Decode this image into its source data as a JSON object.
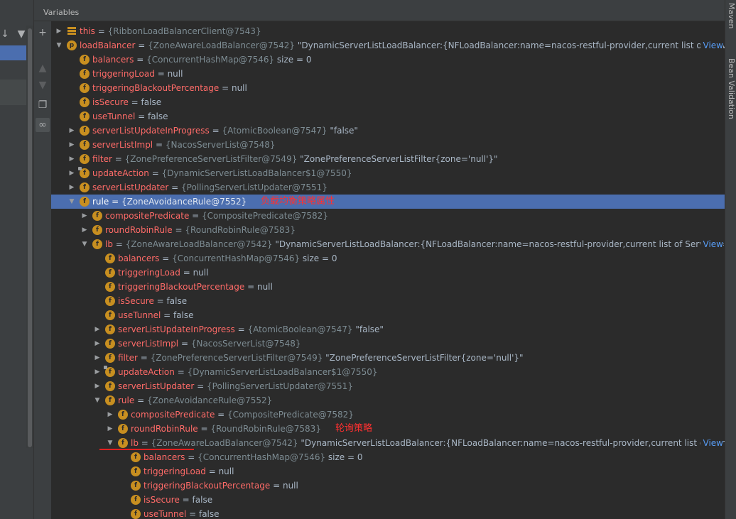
{
  "panel_title": "Variables",
  "view_label": "View",
  "side_tabs": [
    "Maven",
    "Bean Validation"
  ],
  "frames_toolbar": {
    "down_icon": "arrow-down-icon",
    "filter_icon": "filter-icon"
  },
  "vars_toolbar": [
    {
      "icon": "plus-icon",
      "glyph": "+",
      "enabled": true
    },
    {
      "icon": "arrow-up-icon",
      "glyph": "▲",
      "enabled": false
    },
    {
      "icon": "arrow-down-icon",
      "glyph": "▼",
      "enabled": false
    },
    {
      "icon": "copy-icon",
      "glyph": "❐",
      "enabled": true
    },
    {
      "icon": "watch-glasses-icon",
      "glyph": "∞",
      "enabled": true,
      "active": true
    }
  ],
  "annotations": {
    "rule": "负载均衡策略属性",
    "round_robin": "轮询策略"
  },
  "rows": [
    {
      "level": 0,
      "arrow": "collapsed",
      "icon": "stack",
      "name": "this",
      "ref": "{RibbonLoadBalancerClient@7543}",
      "rest": ""
    },
    {
      "level": 0,
      "arrow": "expanded",
      "icon": "p",
      "name": "loadBalancer",
      "ref": "{ZoneAwareLoadBalancer@7542}",
      "rest": " \"DynamicServerListLoadBalancer:{NFLoadBalancer:name=nacos-restful-provider,current list of Serv…",
      "view": true
    },
    {
      "level": 1,
      "arrow": "",
      "icon": "f",
      "name": "balancers",
      "ref": "{ConcurrentHashMap@7546}",
      "rest": "  size = 0"
    },
    {
      "level": 1,
      "arrow": "",
      "icon": "f",
      "name": "triggeringLoad",
      "ref": "",
      "rest": "null"
    },
    {
      "level": 1,
      "arrow": "",
      "icon": "f",
      "name": "triggeringBlackoutPercentage",
      "ref": "",
      "rest": "null"
    },
    {
      "level": 1,
      "arrow": "",
      "icon": "f",
      "name": "isSecure",
      "ref": "",
      "rest": "false"
    },
    {
      "level": 1,
      "arrow": "",
      "icon": "f",
      "name": "useTunnel",
      "ref": "",
      "rest": "false"
    },
    {
      "level": 1,
      "arrow": "collapsed",
      "icon": "f",
      "name": "serverListUpdateInProgress",
      "ref": "{AtomicBoolean@7547}",
      "rest": " \"false\""
    },
    {
      "level": 1,
      "arrow": "collapsed",
      "icon": "f",
      "name": "serverListImpl",
      "ref": "{NacosServerList@7548}",
      "rest": ""
    },
    {
      "level": 1,
      "arrow": "collapsed",
      "icon": "f",
      "name": "filter",
      "ref": "{ZonePreferenceServerListFilter@7549}",
      "rest": " \"ZonePreferenceServerListFilter{zone='null'}\""
    },
    {
      "level": 1,
      "arrow": "collapsed",
      "icon": "f",
      "lock": true,
      "name": "updateAction",
      "ref": "{DynamicServerListLoadBalancer$1@7550}",
      "rest": ""
    },
    {
      "level": 1,
      "arrow": "collapsed",
      "icon": "f",
      "name": "serverListUpdater",
      "ref": "{PollingServerListUpdater@7551}",
      "rest": ""
    },
    {
      "level": 1,
      "arrow": "expanded",
      "icon": "f",
      "name": "rule",
      "ref": "{ZoneAvoidanceRule@7552}",
      "rest": "",
      "selected": true,
      "annotation": "rule"
    },
    {
      "level": 2,
      "arrow": "collapsed",
      "icon": "f",
      "name": "compositePredicate",
      "ref": "{CompositePredicate@7582}",
      "rest": ""
    },
    {
      "level": 2,
      "arrow": "collapsed",
      "icon": "f",
      "name": "roundRobinRule",
      "ref": "{RoundRobinRule@7583}",
      "rest": ""
    },
    {
      "level": 2,
      "arrow": "expanded",
      "icon": "f",
      "name": "lb",
      "ref": "{ZoneAwareLoadBalancer@7542}",
      "rest": " \"DynamicServerListLoadBalancer:{NFLoadBalancer:name=nacos-restful-provider,current list of Servers=[…",
      "view": true
    },
    {
      "level": 3,
      "arrow": "",
      "icon": "f",
      "name": "balancers",
      "ref": "{ConcurrentHashMap@7546}",
      "rest": "  size = 0"
    },
    {
      "level": 3,
      "arrow": "",
      "icon": "f",
      "name": "triggeringLoad",
      "ref": "",
      "rest": "null"
    },
    {
      "level": 3,
      "arrow": "",
      "icon": "f",
      "name": "triggeringBlackoutPercentage",
      "ref": "",
      "rest": "null"
    },
    {
      "level": 3,
      "arrow": "",
      "icon": "f",
      "name": "isSecure",
      "ref": "",
      "rest": "false"
    },
    {
      "level": 3,
      "arrow": "",
      "icon": "f",
      "name": "useTunnel",
      "ref": "",
      "rest": "false"
    },
    {
      "level": 3,
      "arrow": "collapsed",
      "icon": "f",
      "name": "serverListUpdateInProgress",
      "ref": "{AtomicBoolean@7547}",
      "rest": " \"false\""
    },
    {
      "level": 3,
      "arrow": "collapsed",
      "icon": "f",
      "name": "serverListImpl",
      "ref": "{NacosServerList@7548}",
      "rest": ""
    },
    {
      "level": 3,
      "arrow": "collapsed",
      "icon": "f",
      "name": "filter",
      "ref": "{ZonePreferenceServerListFilter@7549}",
      "rest": " \"ZonePreferenceServerListFilter{zone='null'}\""
    },
    {
      "level": 3,
      "arrow": "collapsed",
      "icon": "f",
      "lock": true,
      "name": "updateAction",
      "ref": "{DynamicServerListLoadBalancer$1@7550}",
      "rest": ""
    },
    {
      "level": 3,
      "arrow": "collapsed",
      "icon": "f",
      "name": "serverListUpdater",
      "ref": "{PollingServerListUpdater@7551}",
      "rest": ""
    },
    {
      "level": 3,
      "arrow": "expanded",
      "icon": "f",
      "name": "rule",
      "ref": "{ZoneAvoidanceRule@7552}",
      "rest": ""
    },
    {
      "level": 4,
      "arrow": "collapsed",
      "icon": "f",
      "name": "compositePredicate",
      "ref": "{CompositePredicate@7582}",
      "rest": ""
    },
    {
      "level": 4,
      "arrow": "collapsed",
      "icon": "f",
      "name": "roundRobinRule",
      "ref": "{RoundRobinRule@7583}",
      "rest": "",
      "annotation": "round_robin"
    },
    {
      "level": 4,
      "arrow": "expanded",
      "icon": "f",
      "name": "lb",
      "ref": "{ZoneAwareLoadBalancer@7542}",
      "rest": " \"DynamicServerListLoadBalancer:{NFLoadBalancer:name=nacos-restful-provider,current list of Ser…",
      "view": true,
      "underline": true
    },
    {
      "level": 5,
      "arrow": "",
      "icon": "f",
      "name": "balancers",
      "ref": "{ConcurrentHashMap@7546}",
      "rest": "  size = 0"
    },
    {
      "level": 5,
      "arrow": "",
      "icon": "f",
      "name": "triggeringLoad",
      "ref": "",
      "rest": "null"
    },
    {
      "level": 5,
      "arrow": "",
      "icon": "f",
      "name": "triggeringBlackoutPercentage",
      "ref": "",
      "rest": "null"
    },
    {
      "level": 5,
      "arrow": "",
      "icon": "f",
      "name": "isSecure",
      "ref": "",
      "rest": "false"
    },
    {
      "level": 5,
      "arrow": "",
      "icon": "f",
      "name": "useTunnel",
      "ref": "",
      "rest": "false"
    }
  ]
}
